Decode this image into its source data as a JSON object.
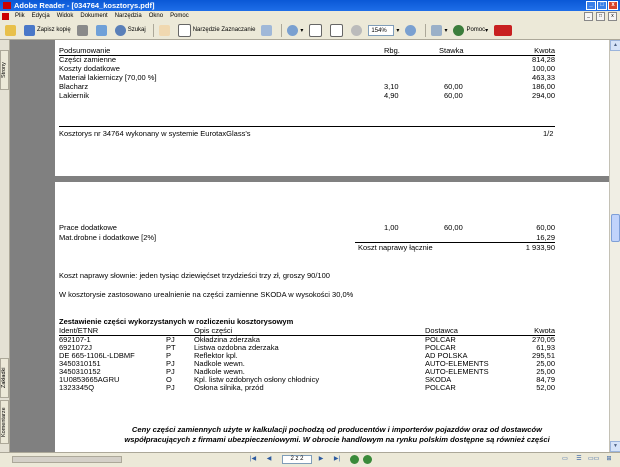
{
  "window": {
    "title": "Adobe Reader - [034764_kosztorys.pdf]",
    "buttons": [
      "_",
      "□",
      "x"
    ]
  },
  "menu": {
    "items": [
      "Plik",
      "Edycja",
      "Widok",
      "Dokument",
      "Narzędzia",
      "Okno",
      "Pomoc"
    ]
  },
  "toolbar": {
    "save_copy": "Zapisz kopię",
    "search": "Szukaj",
    "select_tool": "Narzędzie Zaznaczanie",
    "zoom": "154%",
    "help": "Pomoc"
  },
  "side_tabs": {
    "pages": "Strony",
    "bookmarks": "Zakładki",
    "comments": "Komentarze"
  },
  "page1": {
    "headers": {
      "summary": "Podsumowanie",
      "hours": "Rbg.",
      "rate": "Stawka",
      "amount": "Kwota"
    },
    "rows": [
      {
        "label": "Części zamienne",
        "hours": "",
        "rate": "",
        "amount": "814,28"
      },
      {
        "label": "Koszty dodatkowe",
        "hours": "",
        "rate": "",
        "amount": "100,00"
      },
      {
        "label": "Materiał lakierniczy [70,00 %]",
        "hours": "",
        "rate": "",
        "amount": "463,33"
      },
      {
        "label": "Blacharz",
        "hours": "3,10",
        "rate": "60,00",
        "amount": "186,00"
      },
      {
        "label": "Lakiernik",
        "hours": "4,90",
        "rate": "60,00",
        "amount": "294,00"
      }
    ],
    "footer_text": "Kosztorys nr 34764 wykonany w systemie EurotaxGlass's",
    "footer_page": "1/2"
  },
  "page2": {
    "extra_rows": [
      {
        "label": "Prace dodatkowe",
        "hours": "1,00",
        "rate": "60,00",
        "amount": "60,00"
      },
      {
        "label": "Mat.drobne i dodatkowe [2%]",
        "hours": "",
        "rate": "",
        "amount": "16,29"
      }
    ],
    "total_label": "Koszt naprawy łącznie",
    "total_value": "1 933,90",
    "words_text": "Koszt naprawy słownie: jeden tysiąc dziewięćset trzydzieści trzy zł, groszy 90/100",
    "note_text": "W kosztorysie zastosowano urealnienie na części zamienne SKODA w wysokości 30,0%",
    "parts_title": "Zestawienie części wykorzystanych w rozliczeniu kosztorysowym",
    "parts_headers": {
      "id": "Ident/ETNR",
      "desc": "Opis części",
      "supplier": "Dostawca",
      "amount": "Kwota"
    },
    "parts": [
      {
        "id": "692107-1",
        "code": "PJ",
        "desc": "Okładzina zderzaka",
        "supplier": "POLCAR",
        "amount": "270,05"
      },
      {
        "id": "6921072J",
        "code": "PT",
        "desc": "Listwa ozdobna zderzaka",
        "supplier": "POLCAR",
        "amount": "61,93"
      },
      {
        "id": "DE 665-1106L-LDBMF",
        "code": "P",
        "desc": "Reflektor kpl.",
        "supplier": "AD POLSKA",
        "amount": "295,51"
      },
      {
        "id": "3450310151",
        "code": "PJ",
        "desc": "Nadkole wewn.",
        "supplier": "AUTO-ELEMENTS",
        "amount": "25,00"
      },
      {
        "id": "3450310152",
        "code": "PJ",
        "desc": "Nadkole wewn.",
        "supplier": "AUTO-ELEMENTS",
        "amount": "25,00"
      },
      {
        "id": "1U0853665AGRU",
        "code": "O",
        "desc": "Kpl. listw ozdobnych osłony chłodnicy",
        "supplier": "SKODA",
        "amount": "84,79"
      },
      {
        "id": "1323345Q",
        "code": "PJ",
        "desc": "Osłona silnika, przód",
        "supplier": "POLCAR",
        "amount": "52,00"
      }
    ],
    "italic_line1": "Ceny części zamiennych użyte w kalkulacji pochodzą od producentów i importerów pojazdów oraz od dostawców",
    "italic_line2": "współpracujących z firmami ubezpieczeniowymi. W obrocie handlowym na rynku polskim dostępne są również części"
  },
  "status": {
    "page_indicator": "2 z 2"
  }
}
